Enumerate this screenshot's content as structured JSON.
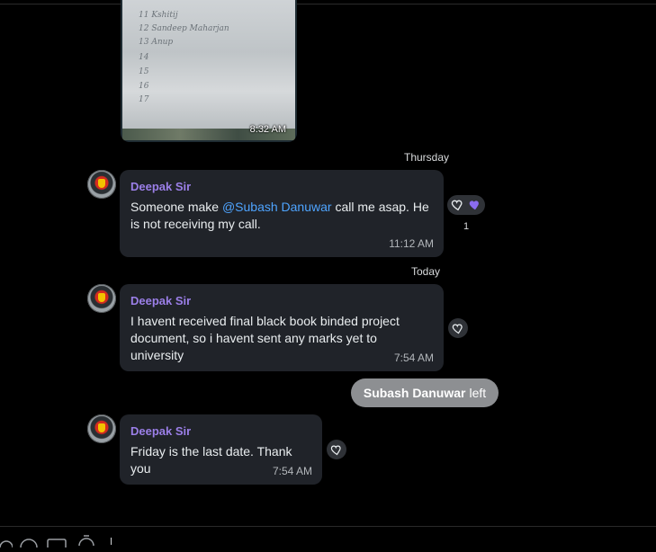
{
  "photo_message": {
    "handwriting": [
      "11  Kshitij",
      "12  Sandeep Maharjan",
      "13  Anup",
      "14",
      "15",
      "16",
      "17"
    ],
    "time": "8:32 AM"
  },
  "days": {
    "thursday": "Thursday",
    "today": "Today"
  },
  "messages": [
    {
      "sender": "Deepak Sir",
      "text_before": "Someone make ",
      "mention": "@Subash Danuwar",
      "text_after": " call me asap. He is not receiving my call.",
      "time": "11:12 AM",
      "reaction_count": "1"
    },
    {
      "sender": "Deepak Sir",
      "text": "I havent received final black book binded project document, so i havent sent any marks yet to university",
      "time": "7:54 AM"
    },
    {
      "sender": "Deepak Sir",
      "text": "Friday is the last date. Thank you",
      "time": "7:54 AM"
    }
  ],
  "system_notice": {
    "name": "Subash Danuwar",
    "action": "left"
  },
  "colors": {
    "background": "#000000",
    "bubble": "#202329",
    "sender": "#9b7fe8",
    "mention": "#4ea4ff",
    "reaction_heart": "#8a6cf0",
    "system_pill": "#8d8f92"
  },
  "icons": [
    "heart-outline-icon",
    "heart-filled-icon",
    "avatar-icon",
    "emoji-icon",
    "sticker-icon",
    "timer-icon"
  ]
}
